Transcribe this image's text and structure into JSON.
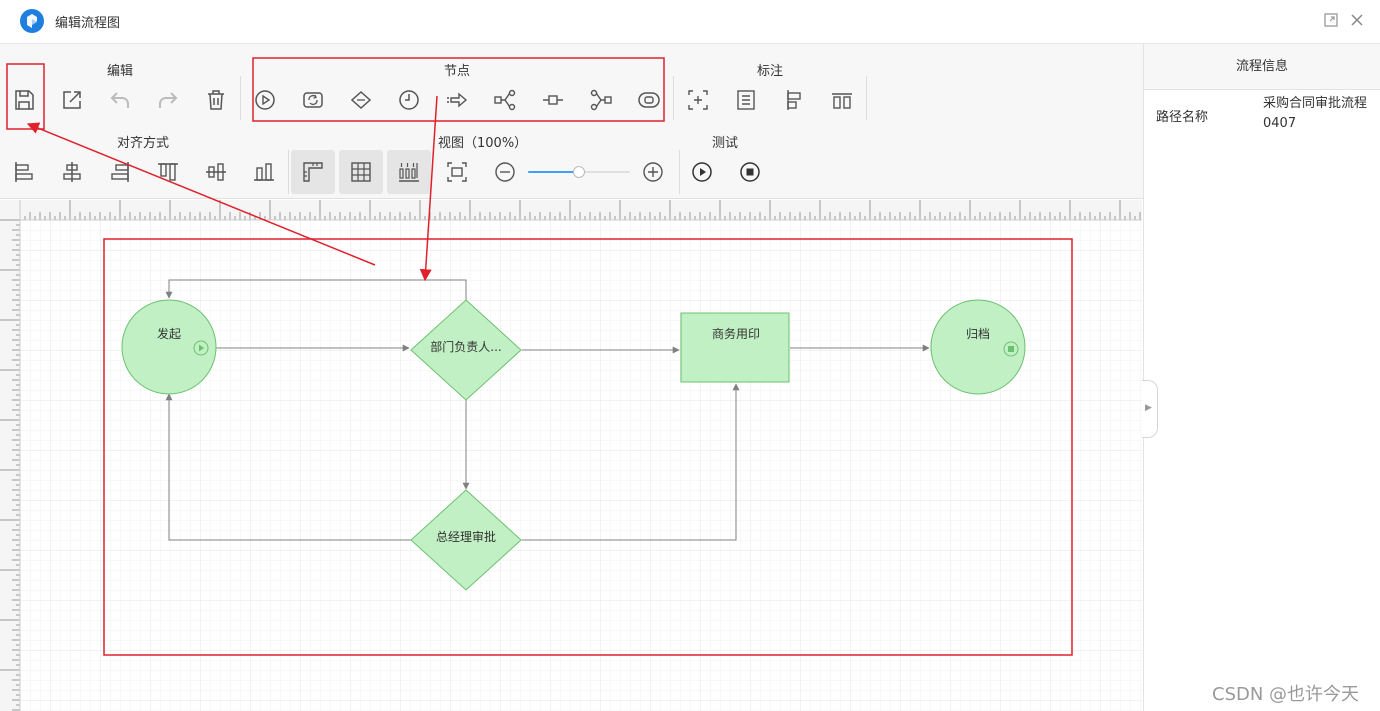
{
  "window": {
    "title": "编辑流程图",
    "icons": {
      "logo": "app-logo-icon",
      "maximize": "maximize-icon",
      "close": "close-icon"
    }
  },
  "toolbar": {
    "groups": {
      "edit": "编辑",
      "node": "节点",
      "annotation": "标注",
      "align": "对齐方式",
      "view": "视图（100%）",
      "test": "测试"
    },
    "zoom_percent": 100,
    "edit_buttons": [
      "save-icon",
      "export-icon",
      "undo-icon",
      "redo-icon",
      "delete-icon"
    ],
    "node_buttons": [
      "start-node-icon",
      "loop-node-icon",
      "condition-node-icon",
      "timer-node-icon",
      "route-node-icon",
      "branch-node-icon",
      "single-node-icon",
      "merge-node-icon",
      "end-node-icon"
    ],
    "annotation_buttons": [
      "annotation-box-icon",
      "text-note-icon",
      "align-group-icon",
      "distribute-icon"
    ],
    "align_buttons": [
      "align-left-icon",
      "align-center-h-icon",
      "align-right-icon",
      "align-top-icon",
      "align-middle-icon",
      "align-bottom-icon"
    ],
    "view_buttons": [
      "ruler-icon",
      "grid-icon",
      "guide-icon",
      "fit-screen-icon",
      "zoom-out-icon",
      "zoom-in-icon"
    ],
    "test_buttons": [
      "play-icon",
      "stop-icon"
    ]
  },
  "right_panel": {
    "header": "流程信息",
    "fields": [
      {
        "label": "路径名称",
        "value": "采购合同审批流程0407"
      }
    ]
  },
  "flow": {
    "nodes": [
      {
        "id": "start",
        "shape": "circle",
        "label": "发起",
        "badge": "start-badge-icon"
      },
      {
        "id": "dept",
        "shape": "diamond",
        "label": "部门负责人..."
      },
      {
        "id": "seal",
        "shape": "rect",
        "label": "商务用印"
      },
      {
        "id": "archive",
        "shape": "circle",
        "label": "归档",
        "badge": "end-badge-icon"
      },
      {
        "id": "gm",
        "shape": "diamond",
        "label": "总经理审批"
      }
    ],
    "edges": [
      {
        "from": "start",
        "to": "dept"
      },
      {
        "from": "dept",
        "to": "seal"
      },
      {
        "from": "seal",
        "to": "archive"
      },
      {
        "from": "dept",
        "to": "gm"
      },
      {
        "from": "gm",
        "to": "seal"
      },
      {
        "from": "gm",
        "to": "start"
      },
      {
        "from": "dept",
        "to": "start"
      }
    ],
    "colors": {
      "node_fill": "#c1f0c4",
      "node_stroke": "#6cc06f",
      "edge": "#808080",
      "highlight": "#e0212b"
    }
  },
  "watermark": "CSDN @也许今天"
}
